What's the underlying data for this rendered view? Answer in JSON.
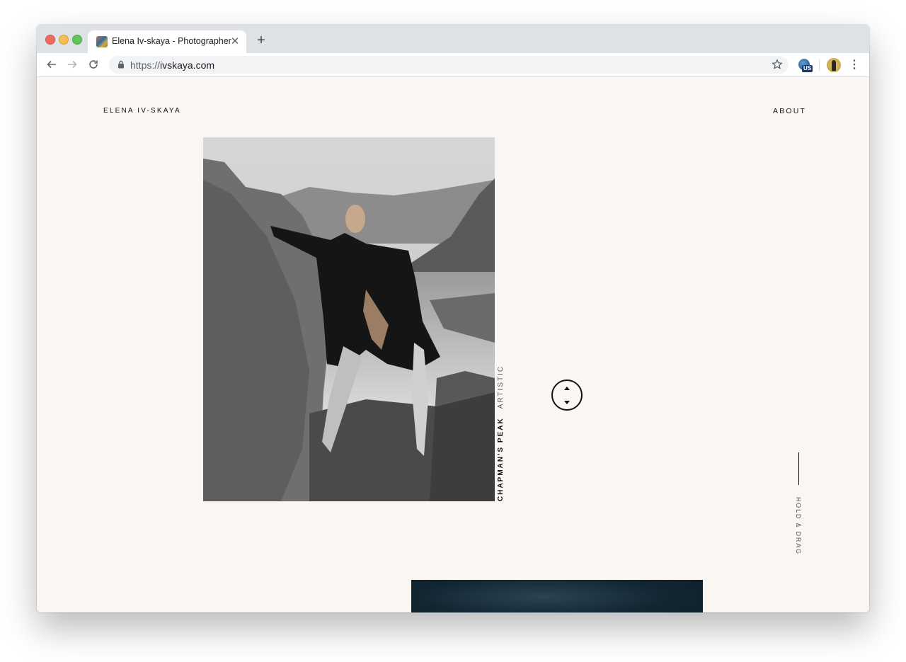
{
  "browser": {
    "tab": {
      "title": "Elena Iv-skaya - Photographer"
    },
    "address_bar": {
      "scheme": "https://",
      "host": "ivskaya.com"
    },
    "extensions": {
      "badge": "US"
    }
  },
  "site": {
    "brand": "ELENA IV-SKAYA",
    "nav": {
      "about": "ABOUT"
    },
    "featured": {
      "title": "CHAPMAN'S PEAK",
      "tag": "ARTISTIC"
    },
    "hold_drag": "HOLD & DRAG"
  },
  "colors": {
    "page_background": "#faf7f2",
    "text": "#111111",
    "tab_strip": "#dee1e6"
  },
  "icons": {
    "back": "arrow-left-icon",
    "forward": "arrow-right-icon",
    "reload": "reload-icon",
    "lock": "lock-icon",
    "bookmark": "star-icon",
    "menu": "kebab-icon"
  }
}
